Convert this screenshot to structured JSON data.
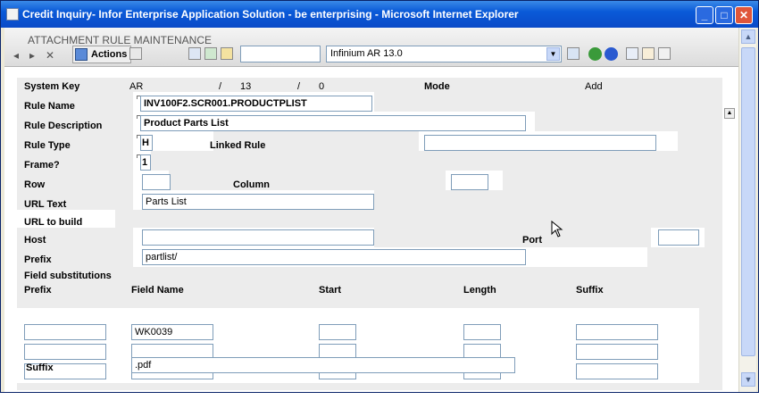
{
  "window": {
    "title": "Credit Inquiry- Infor Enterprise Application Solution - be enterprising - Microsoft Internet Explorer",
    "min": "_",
    "max": "□",
    "close": "✕"
  },
  "toolbar": {
    "screen_title": "ATTACHMENT RULE MAINTENANCE",
    "back": "◂",
    "forward": "▸",
    "close": "✕",
    "actions_label": "Actions",
    "search_value": "",
    "product_select": "Infinium AR 13.0"
  },
  "form": {
    "system_key": {
      "label": "System Key",
      "v1": "AR",
      "sep1": "/",
      "v2": "13",
      "sep2": "/",
      "v3": "0"
    },
    "mode": {
      "label": "Mode",
      "value": "Add"
    },
    "rule_name": {
      "label": "Rule Name",
      "value": "INV100F2.SCR001.PRODUCTPLIST"
    },
    "rule_description": {
      "label": "Rule Description",
      "value": "Product Parts List"
    },
    "rule_type": {
      "label": "Rule Type",
      "value": "H"
    },
    "linked_rule": {
      "label": "Linked Rule",
      "value": ""
    },
    "frame": {
      "label": "Frame?",
      "value": "1"
    },
    "row": {
      "label": "Row",
      "value": ""
    },
    "column": {
      "label": "Column",
      "value": ""
    },
    "url_text": {
      "label": "URL Text",
      "value": "Parts List"
    },
    "url_to_build": {
      "label": "URL to build"
    },
    "host": {
      "label": "Host",
      "value": ""
    },
    "port": {
      "label": "Port",
      "value": ""
    },
    "prefix": {
      "label": "Prefix",
      "value": "partlist/"
    },
    "field_substitutions": {
      "label": "Field substitutions",
      "headers": {
        "prefix": "Prefix",
        "field_name": "Field Name",
        "start": "Start",
        "length": "Length",
        "suffix": "Suffix"
      },
      "rows": [
        {
          "prefix": "",
          "field_name": "WK0039",
          "start": "",
          "length": "",
          "suffix": ""
        },
        {
          "prefix": "",
          "field_name": "",
          "start": "",
          "length": "",
          "suffix": ""
        },
        {
          "prefix": "",
          "field_name": "",
          "start": "",
          "length": "",
          "suffix": ""
        }
      ]
    },
    "suffix": {
      "label": "Suffix",
      "value": ".pdf"
    }
  }
}
